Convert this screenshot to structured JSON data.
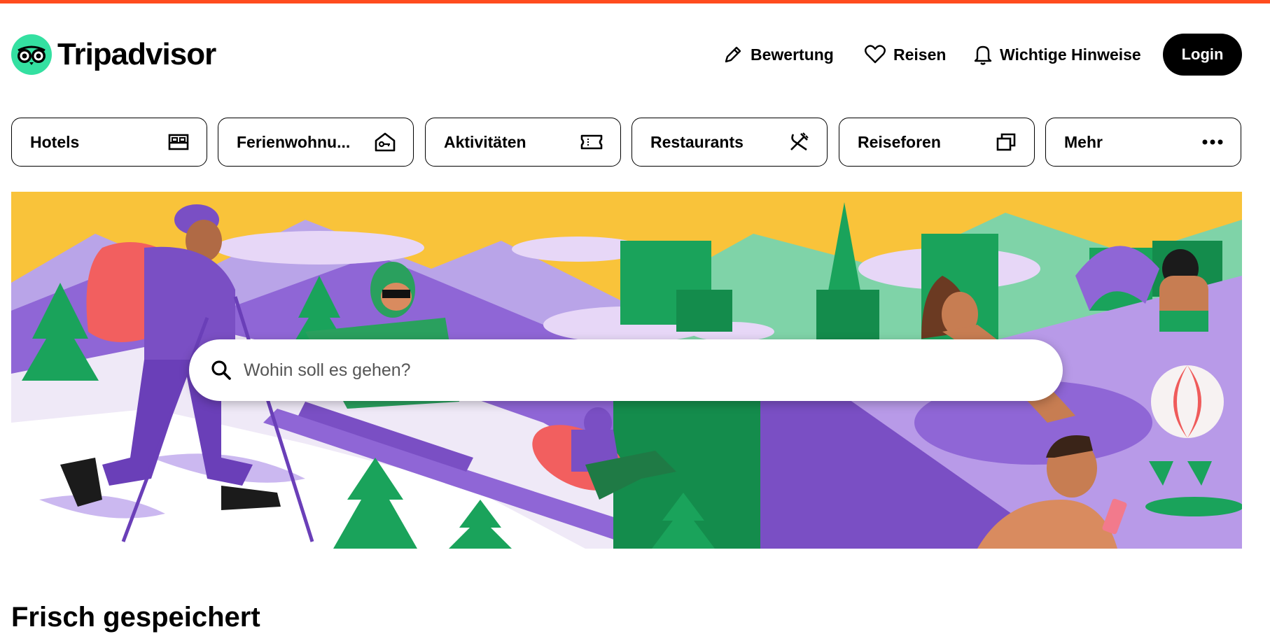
{
  "brand": {
    "name": "Tripadvisor",
    "logo_color": "#34e0a1",
    "top_bar_color": "#ff4c1f"
  },
  "header": {
    "nav": [
      {
        "label": "Bewertung",
        "icon": "pencil-icon"
      },
      {
        "label": "Reisen",
        "icon": "heart-icon"
      },
      {
        "label": "Wichtige Hinweise",
        "icon": "bell-icon"
      }
    ],
    "login_label": "Login"
  },
  "categories": [
    {
      "label": "Hotels",
      "icon": "bed-icon"
    },
    {
      "label": "Ferienwohnu...",
      "icon": "house-key-icon"
    },
    {
      "label": "Aktivitäten",
      "icon": "ticket-icon"
    },
    {
      "label": "Restaurants",
      "icon": "fork-knife-icon"
    },
    {
      "label": "Reiseforen",
      "icon": "chat-bubbles-icon"
    },
    {
      "label": "Mehr",
      "icon": "more-dots-icon"
    }
  ],
  "search": {
    "placeholder": "Wohin soll es gehen?",
    "icon": "search-icon"
  },
  "section": {
    "title": "Frisch gespeichert"
  }
}
